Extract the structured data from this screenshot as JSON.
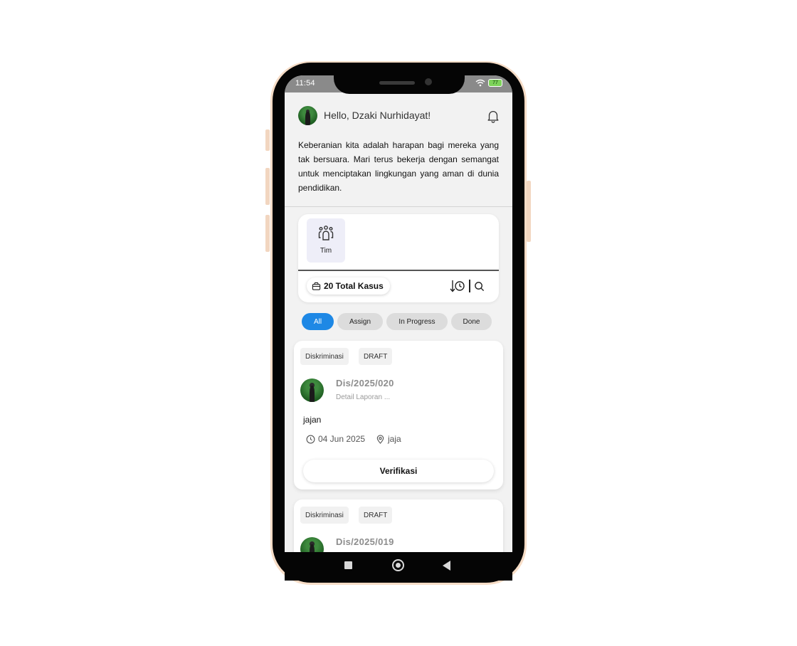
{
  "status_bar": {
    "time": "11:54",
    "battery": "77"
  },
  "header": {
    "greeting": "Hello, Dzaki Nurhidayat!",
    "quote": "Keberanian kita adalah harapan bagi mereka yang tak bersuara. Mari terus bekerja dengan semangat untuk menciptakan lingkungan yang aman di dunia pendidikan."
  },
  "summary": {
    "tile_label": "Tim",
    "total_label": "20 Total Kasus"
  },
  "filters": [
    {
      "label": "All",
      "active": true
    },
    {
      "label": "Assign",
      "active": false
    },
    {
      "label": "In Progress",
      "active": false
    },
    {
      "label": "Done",
      "active": false
    }
  ],
  "cases": [
    {
      "category": "Diskriminasi",
      "status": "DRAFT",
      "number": "Dis/2025/020",
      "subtitle": "Detail Laporan ...",
      "description": "jajan",
      "date": "04 Jun 2025",
      "location": "jaja",
      "action": "Verifikasi"
    },
    {
      "category": "Diskriminasi",
      "status": "DRAFT",
      "number": "Dis/2025/019"
    }
  ],
  "colors": {
    "accent": "#1e88e5",
    "chip_bg": "#dcdcdc",
    "screen_bg": "#f2f2f2",
    "frame": "#f6dcc6"
  }
}
